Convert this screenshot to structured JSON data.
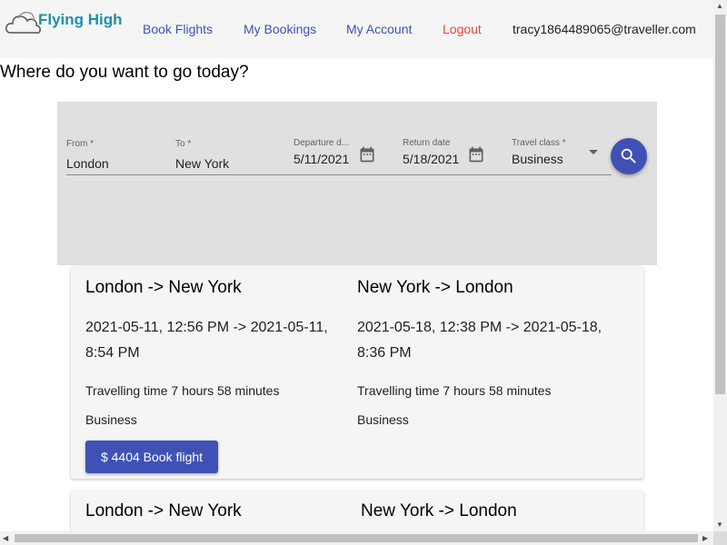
{
  "header": {
    "logo_text": "Flying High",
    "nav": {
      "book_flights": "Book Flights",
      "my_bookings": "My Bookings",
      "my_account": "My Account",
      "logout": "Logout"
    },
    "user_email": "tracy1864489065@traveller.com"
  },
  "headline": "Where do you want to go today?",
  "search": {
    "from_label": "From *",
    "from_value": "London",
    "to_label": "To *",
    "to_value": "New York",
    "departure_label": "Departure d...",
    "departure_value": "5/11/2021",
    "return_label": "Return date",
    "return_value": "5/18/2021",
    "class_label": "Travel class *",
    "class_value": "Business"
  },
  "results": [
    {
      "outbound": {
        "route": "London -> New York",
        "times": "2021-05-11, 12:56 PM -> 2021-05-11, 8:54 PM",
        "travel_time": "Travelling time 7 hours 58 minutes",
        "class": "Business"
      },
      "inbound": {
        "route": "New York -> London",
        "times": "2021-05-18, 12:38 PM -> 2021-05-18, 8:36 PM",
        "travel_time": "Travelling time 7 hours 58 minutes",
        "class": "Business"
      },
      "book_label": "$ 4404 Book flight"
    },
    {
      "outbound": {
        "route": "London -> New York"
      },
      "inbound": {
        "route": "New York -> London"
      }
    }
  ],
  "colors": {
    "primary": "#3f51b5",
    "logout": "#f44336",
    "logo": "#1f8fa8",
    "panel": "#e0e0e0",
    "header_bg": "#f5f5f5"
  },
  "icons": [
    "cloud-logo-icon",
    "calendar-icon",
    "dropdown-arrow-icon",
    "search-icon"
  ]
}
